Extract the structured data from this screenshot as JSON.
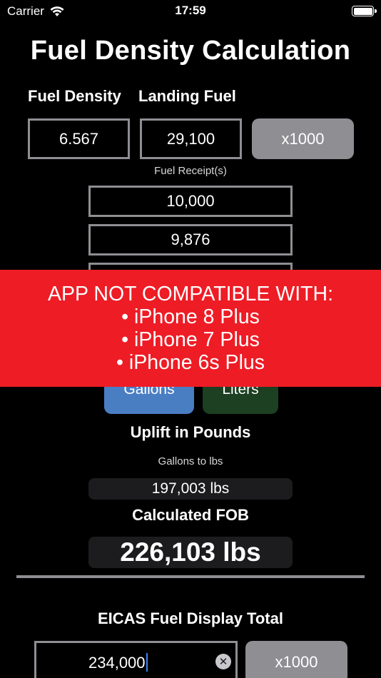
{
  "status_bar": {
    "carrier": "Carrier",
    "time": "17:59"
  },
  "title": "Fuel Density Calculation",
  "labels": {
    "fuel_density": "Fuel Density",
    "landing_fuel": "Landing Fuel"
  },
  "inputs": {
    "fuel_density": "6.567",
    "landing_fuel": "29,100",
    "multiplier_label": "x1000"
  },
  "fuel_receipts": {
    "label": "Fuel Receipt(s)",
    "values": [
      "10,000",
      "9,876"
    ]
  },
  "units": {
    "gallons": "Gallons",
    "liters": "Liters"
  },
  "banner": {
    "lines": [
      "APP NOT COMPATIBLE WITH:",
      "• iPhone 8 Plus",
      "• iPhone 7 Plus",
      "• iPhone 6s Plus"
    ]
  },
  "uplift": {
    "heading": "Uplift in Pounds",
    "conversion_label": "Gallons to lbs",
    "value": "197,003 lbs"
  },
  "fob": {
    "heading": "Calculated FOB",
    "value": "226,103 lbs"
  },
  "eicas": {
    "heading": "EICAS Fuel Display Total",
    "value": "234,000",
    "multiplier_label": "x1000"
  },
  "colors": {
    "banner": "#ee1c25",
    "gallons_button": "#4a7ec3",
    "liters_button": "#1d3f22",
    "gray_button": "#8e8e93",
    "cursor": "#3a82f7"
  }
}
